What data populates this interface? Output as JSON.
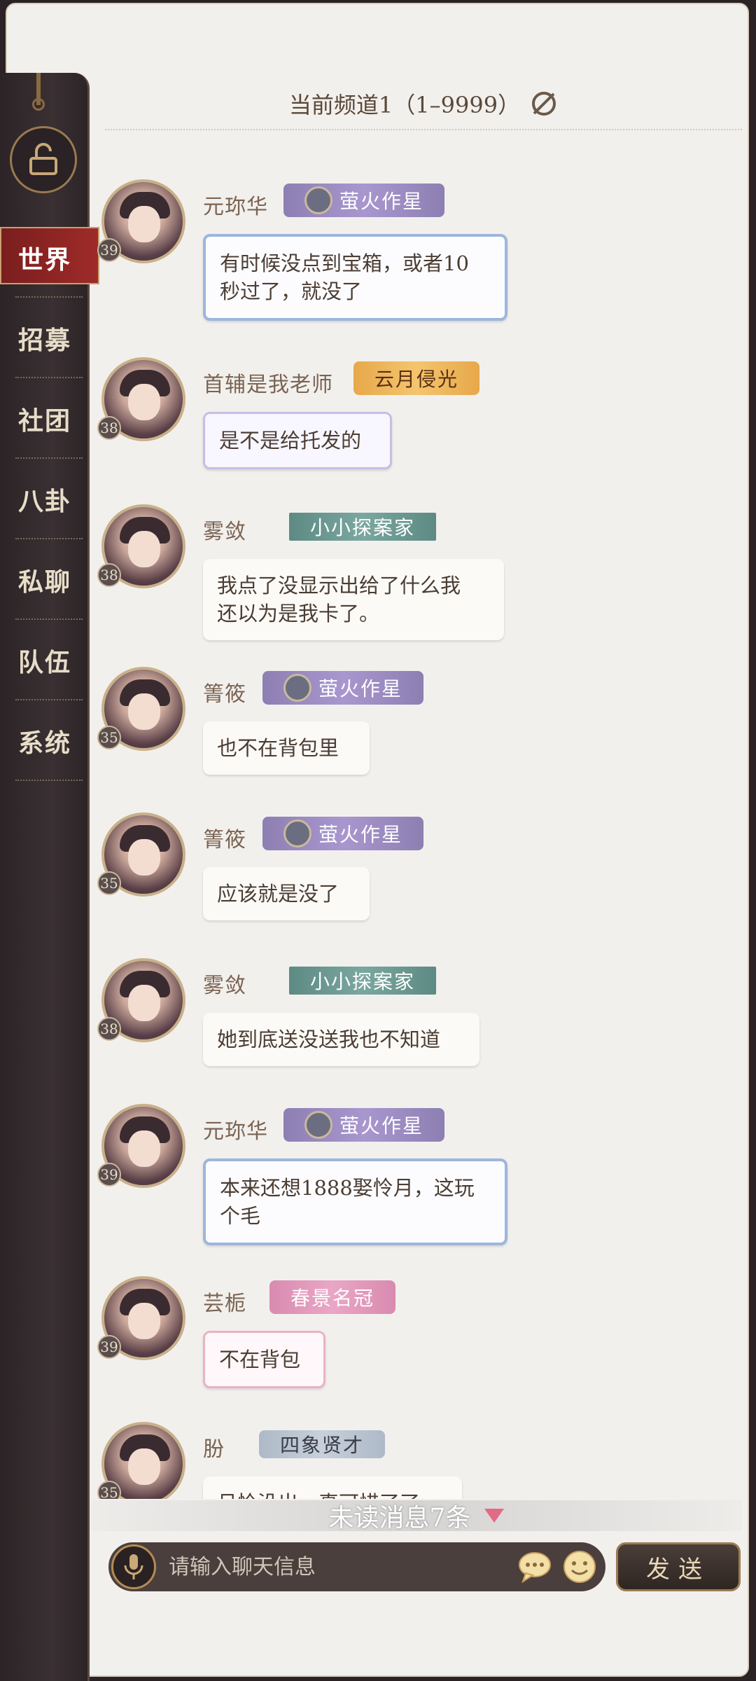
{
  "channel": {
    "title": "当前频道1（1–9999）",
    "icon": "eye-off-icon"
  },
  "sidebar": {
    "lock_icon": "lock-icon",
    "items": [
      {
        "label": "世界",
        "active": true
      },
      {
        "label": "招募"
      },
      {
        "label": "社团"
      },
      {
        "label": "八卦"
      },
      {
        "label": "私聊"
      },
      {
        "label": "队伍"
      },
      {
        "label": "系统"
      }
    ]
  },
  "messages": [
    {
      "name": "元珎华",
      "level": "39",
      "badge": "萤火作星",
      "text": "有时候没点到宝箱，或者10\n秒过了，就没了"
    },
    {
      "name": "首辅是我老师",
      "level": "38",
      "badge": "云月侵光",
      "text": "是不是给托发的"
    },
    {
      "name": "雾敛",
      "level": "38",
      "badge": "小小探案家",
      "text": "我点了没显示出给了什么我\n还以为是我卡了。"
    },
    {
      "name": "箐筱",
      "level": "35",
      "badge": "萤火作星",
      "text": "也不在背包里"
    },
    {
      "name": "箐筱",
      "level": "35",
      "badge": "萤火作星",
      "text": "应该就是没了"
    },
    {
      "name": "雾敛",
      "level": "38",
      "badge": "小小探案家",
      "text": "她到底送没送我也不知道"
    },
    {
      "name": "元珎华",
      "level": "39",
      "badge": "萤火作星",
      "text": "本来还想1888娶怜月，这玩\n个毛"
    },
    {
      "name": "芸栀",
      "level": "39",
      "badge": "春景名冠",
      "text": "不在背包"
    },
    {
      "name": "朌",
      "level": "35",
      "badge": "四象贤才",
      "text": "月怜没出，真可惜了了"
    }
  ],
  "unread": {
    "label": "未读消息7条",
    "icon": "down-arrow-icon"
  },
  "input": {
    "placeholder": "请输入聊天信息",
    "mic_icon": "microphone-icon",
    "chat_icon": "speech-bubble-icon",
    "emoji_icon": "emoji-icon"
  },
  "send": {
    "label": "发送"
  },
  "colors": {
    "active_tab": "#9e2b28",
    "panel_bg": "#f2f0ed",
    "sidebar_bg": "#332a2c"
  }
}
